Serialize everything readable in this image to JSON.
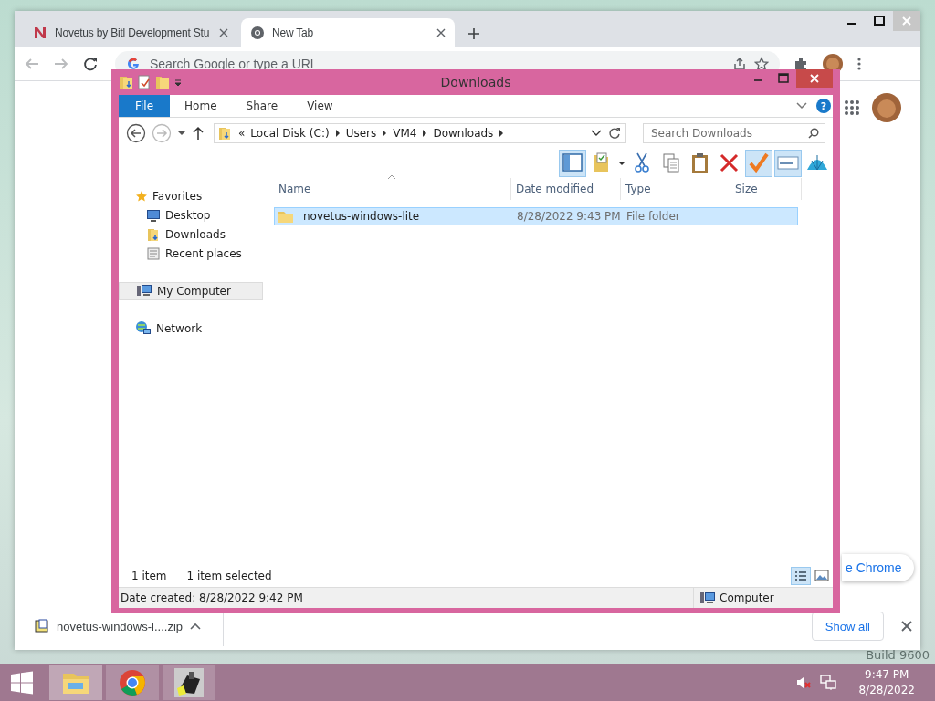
{
  "desktop": {
    "watermark": "Build 9600"
  },
  "browser": {
    "tabs": [
      {
        "title": "Novetus by Bitl Development Stu",
        "kind": "novetus",
        "selected": false
      },
      {
        "title": "New Tab",
        "kind": "newtab",
        "selected": true
      }
    ],
    "omnibox": {
      "placeholder": "Search Google or type a URL"
    },
    "customize_button": "e Chrome",
    "download": {
      "file": "novetus-windows-l....zip"
    },
    "show_all": "Show all"
  },
  "explorer": {
    "title": "Downloads",
    "ribbon_tabs": [
      {
        "label": "File",
        "kind": "file"
      },
      {
        "label": "Home",
        "kind": "tab"
      },
      {
        "label": "Share",
        "kind": "tab"
      },
      {
        "label": "View",
        "kind": "tab"
      }
    ],
    "help": "?",
    "path_overflow": "«",
    "path": [
      "Local Disk (C:)",
      "Users",
      "VM4",
      "Downloads"
    ],
    "search": {
      "placeholder": "Search Downloads"
    },
    "tools": [
      {
        "kind": "pane",
        "on": true
      },
      {
        "kind": "properties",
        "on": false
      },
      {
        "kind": "cut",
        "on": false
      },
      {
        "kind": "copy",
        "on": false
      },
      {
        "kind": "paste",
        "on": false
      },
      {
        "kind": "delete",
        "on": false
      },
      {
        "kind": "check",
        "on": true
      },
      {
        "kind": "rename",
        "on": true
      },
      {
        "kind": "globe",
        "on": false
      }
    ],
    "nav": [
      {
        "label": "Favorites",
        "kind": "star",
        "selected": false,
        "children": [
          {
            "label": "Desktop",
            "kind": "desktop",
            "selected": false
          },
          {
            "label": "Downloads",
            "kind": "downloads",
            "selected": false
          },
          {
            "label": "Recent places",
            "kind": "recent",
            "selected": false
          }
        ]
      },
      {
        "label": "My Computer",
        "kind": "computer",
        "selected": true
      },
      {
        "label": "Network",
        "kind": "network",
        "selected": false
      }
    ],
    "columns": [
      "Name",
      "Date modified",
      "Type",
      "Size"
    ],
    "rows": [
      {
        "name": "novetus-windows-lite",
        "date": "8/28/2022 9:43 PM",
        "type": "File folder",
        "selected": true
      }
    ],
    "item_count": "1 item",
    "selection_count": "1 item selected",
    "status": "Date created: 8/28/2022 9:42 PM",
    "location": "Computer"
  },
  "taskbar": {
    "apps": [
      {
        "kind": "explorer",
        "selected": true
      },
      {
        "kind": "chrome",
        "selected": false
      },
      {
        "kind": "game",
        "selected": false
      }
    ],
    "time": "9:47 PM",
    "date": "8/28/2022"
  }
}
